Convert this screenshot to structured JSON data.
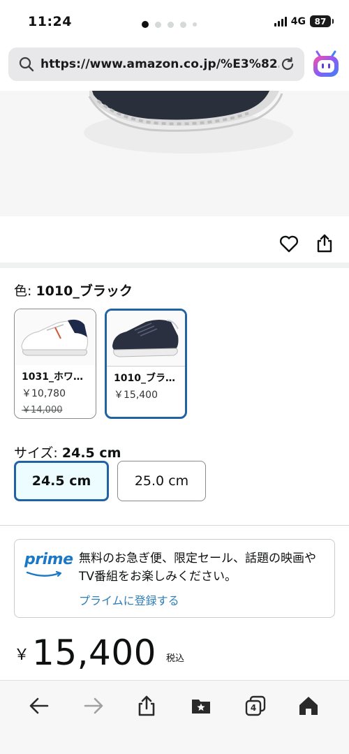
{
  "status_bar": {
    "time": "11:24",
    "network": "4G",
    "battery": "87"
  },
  "browser": {
    "url": "https://www.amazon.co.jp/%E3%82...",
    "tabs_count": "4"
  },
  "gallery": {
    "total_images": 5,
    "active_index": 0
  },
  "color": {
    "label": "色: ",
    "selected": "1010_ブラック",
    "options": [
      {
        "name": "1031_ホワ…",
        "price": "￥10,780",
        "list_price": "￥14,000",
        "selected": false
      },
      {
        "name": "1010_ブラ…",
        "price": "￥15,400",
        "list_price": "",
        "selected": true
      }
    ]
  },
  "size": {
    "label": "サイズ: ",
    "selected": "24.5 cm",
    "options": [
      "24.5 cm",
      "25.0 cm"
    ]
  },
  "prime": {
    "logo": "prime",
    "message": "無料のお急ぎ便、限定セール、話題の映画やTV番組をお楽しみください。",
    "link": "プライムに登録する",
    "color": "#1b78c7"
  },
  "price": {
    "currency": "￥",
    "amount": "15,400",
    "tax_note": "税込"
  },
  "colors": {
    "selected_border": "#2162a1",
    "selected_fill": "#edfdff",
    "link": "#2e7eb8"
  }
}
